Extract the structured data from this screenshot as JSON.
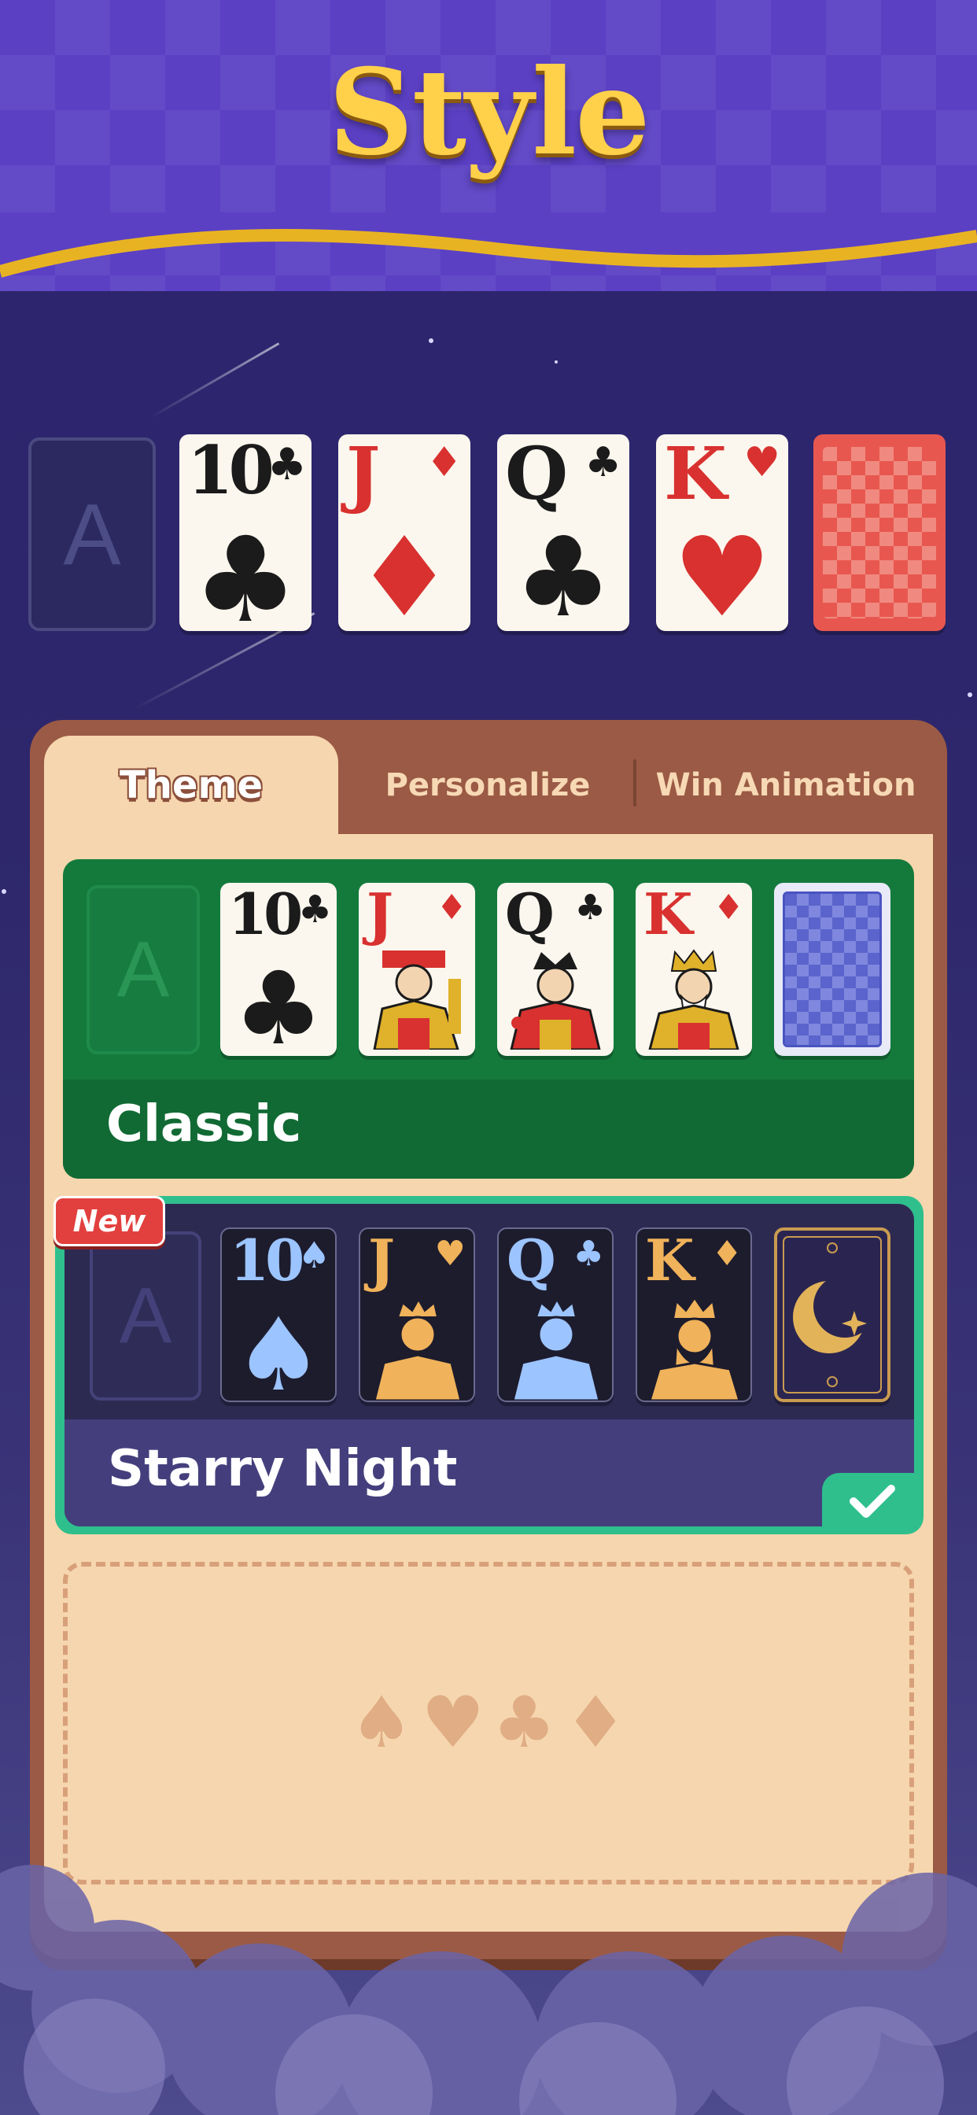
{
  "title": "Style",
  "preview": {
    "placeholder_label": "A",
    "cards": [
      {
        "rank": "10",
        "suit": "♣",
        "color": "black"
      },
      {
        "rank": "J",
        "suit": "♦",
        "color": "red"
      },
      {
        "rank": "Q",
        "suit": "♣",
        "color": "black"
      },
      {
        "rank": "K",
        "suit": "♥",
        "color": "red"
      }
    ],
    "back_style": "red-checker"
  },
  "tabs": [
    {
      "label": "Theme",
      "active": true
    },
    {
      "label": "Personalize",
      "active": false
    },
    {
      "label": "Win Animation",
      "active": false
    }
  ],
  "themes": [
    {
      "name": "Classic",
      "placeholder_label": "A",
      "cards": [
        {
          "rank": "10",
          "suit": "♣",
          "color": "black"
        },
        {
          "rank": "J",
          "suit": "♦",
          "color": "red"
        },
        {
          "rank": "Q",
          "suit": "♣",
          "color": "black"
        },
        {
          "rank": "K",
          "suit": "♦",
          "color": "red"
        }
      ],
      "back_style": "blue-diamond",
      "selected": false,
      "is_new": false
    },
    {
      "name": "Starry Night",
      "badge": "New",
      "placeholder_label": "A",
      "cards": [
        {
          "rank": "10",
          "suit": "♠",
          "color": "light-blue"
        },
        {
          "rank": "J",
          "suit": "♥",
          "color": "gold"
        },
        {
          "rank": "Q",
          "suit": "♣",
          "color": "light-blue"
        },
        {
          "rank": "K",
          "suit": "♦",
          "color": "gold"
        }
      ],
      "back_style": "moon",
      "selected": true,
      "is_new": true
    }
  ],
  "empty_slot": {
    "suits": [
      "♠",
      "♥",
      "♣",
      "♦"
    ]
  },
  "colors": {
    "header": "#5b40c4",
    "title": "#ffd04a",
    "panel": "#9b5a45",
    "panel_inner": "#f6d6ae",
    "classic_green": "#147a3c",
    "selected_border": "#2fbf8d",
    "new_badge": "#e2403e"
  }
}
